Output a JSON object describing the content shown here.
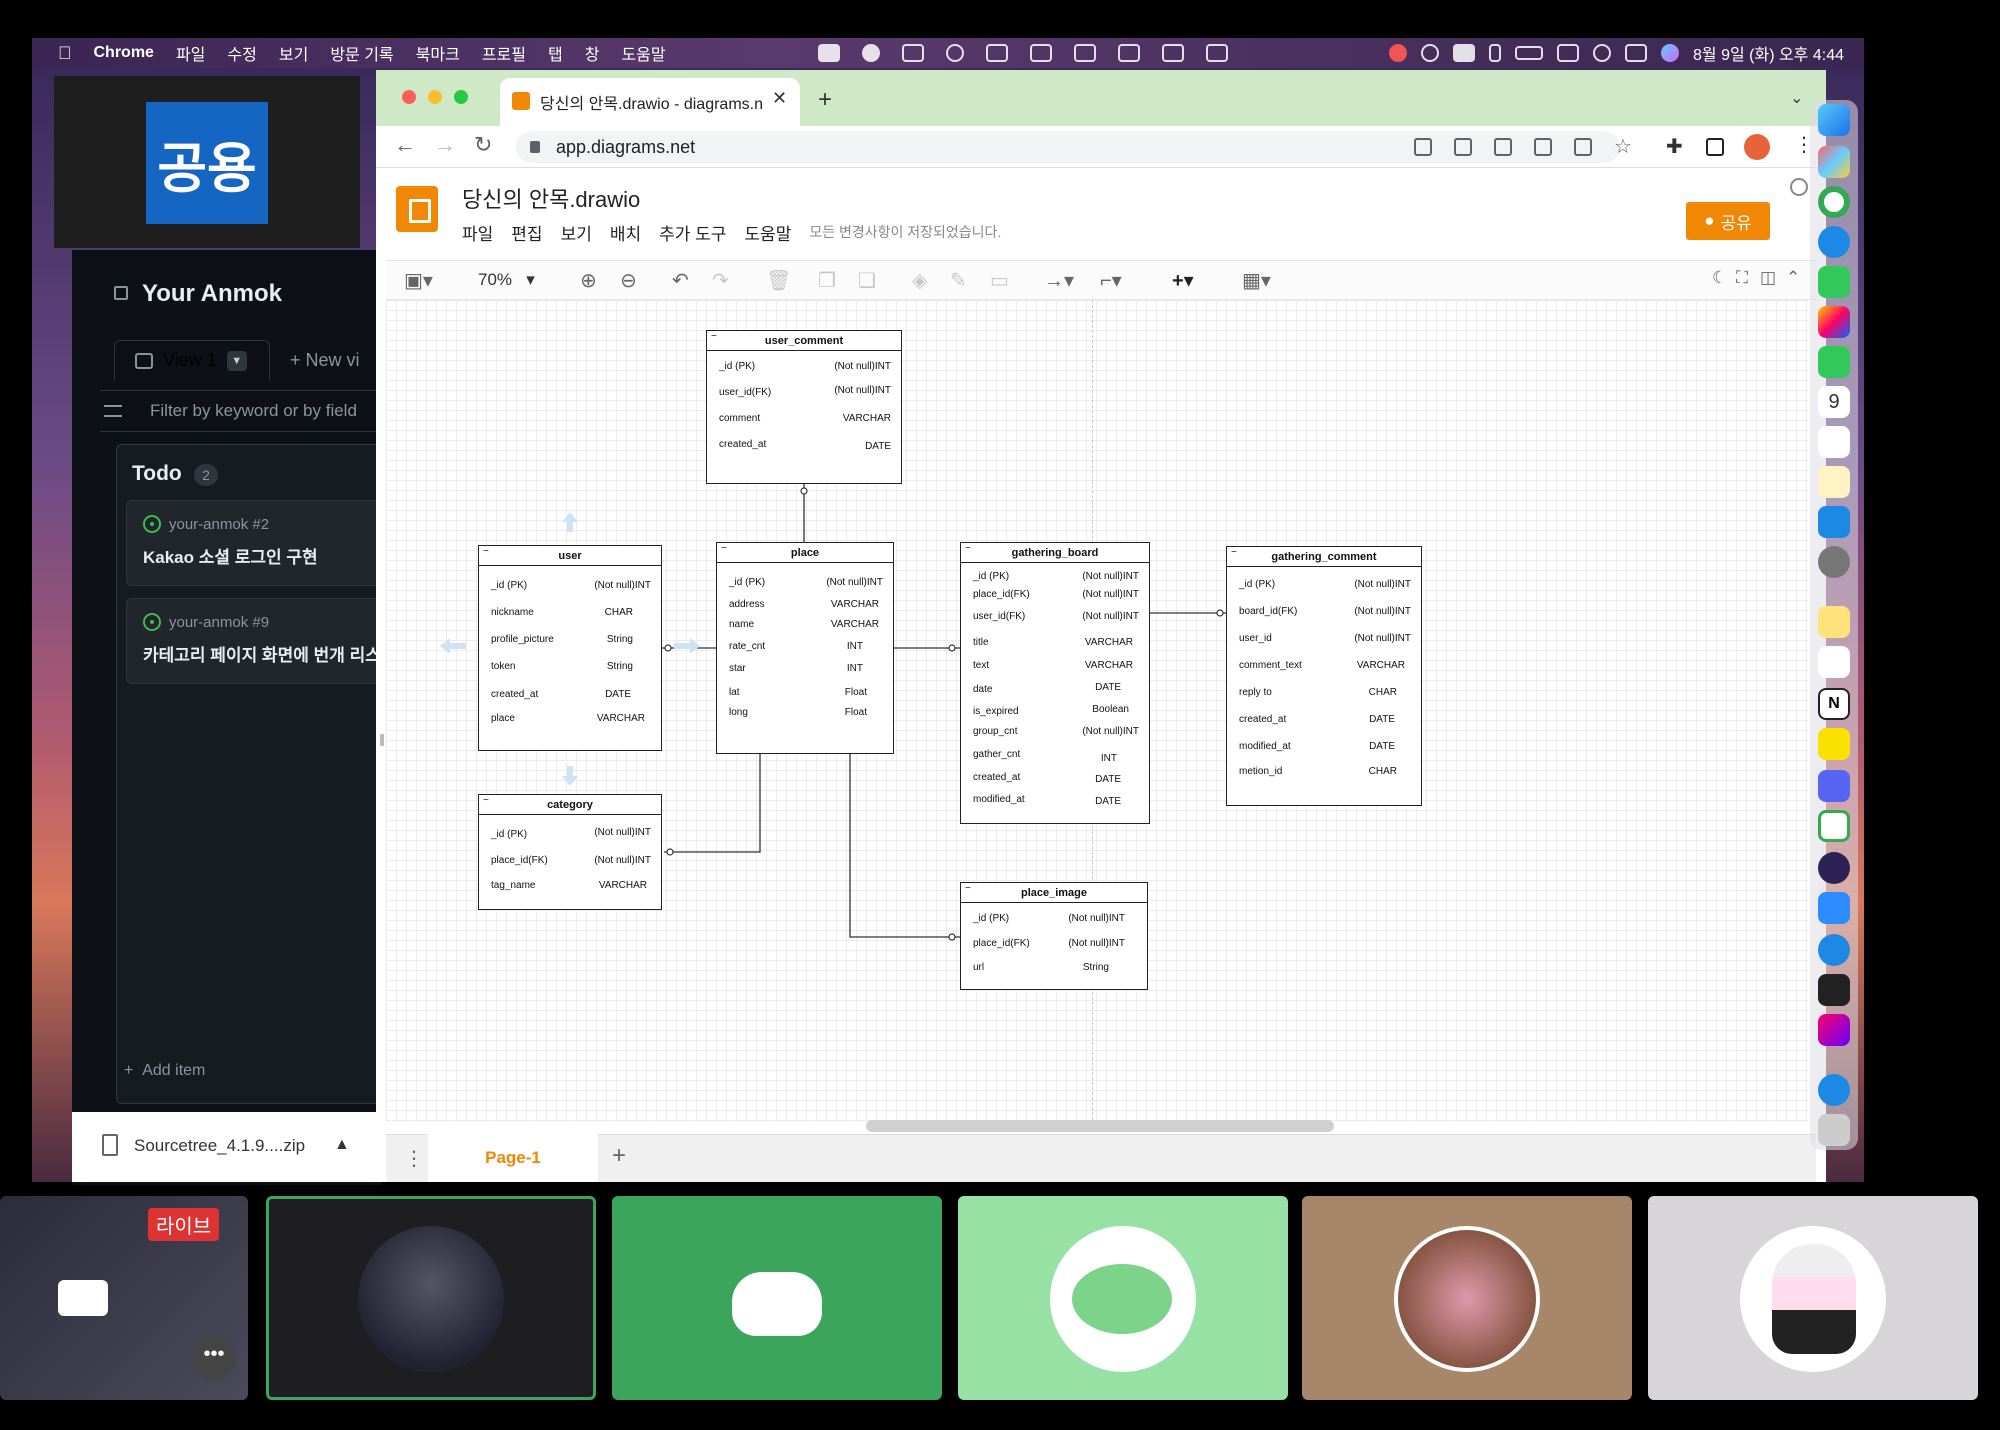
{
  "menubar": {
    "app": "Chrome",
    "items": [
      "파일",
      "수정",
      "보기",
      "방문 기록",
      "북마크",
      "프로필",
      "탭",
      "창",
      "도움말"
    ],
    "clock": "8월 9일 (화) 오후 4:44"
  },
  "share_logo": "공용",
  "github": {
    "project_title": "Your Anmok",
    "view_tab": "View 1",
    "new_view": "New vi",
    "filter_placeholder": "Filter by keyword or by field",
    "column_title": "Todo",
    "column_count": "2",
    "cards": [
      {
        "ref": "your-anmok #2",
        "title": "Kakao 소셜 로그인 구현"
      },
      {
        "ref": "your-anmok #9",
        "title": "카테고리 페이지 화면에 번개 리스"
      }
    ],
    "add_item": "Add item"
  },
  "download": {
    "file": "Sourcetree_4.1.9....zip"
  },
  "browser": {
    "tab_title": "당신의 안목.drawio - diagrams.n",
    "url": "app.diagrams.net"
  },
  "drawio": {
    "file_title": "당신의 안목.drawio",
    "menu": [
      "파일",
      "편집",
      "보기",
      "배치",
      "추가 도구",
      "도움말"
    ],
    "saved_status": "모든 변경사항이 저장되었습니다.",
    "share_button": "공유",
    "zoom": "70%",
    "page_tab": "Page-1"
  },
  "diagram": {
    "tables": {
      "user_comment": {
        "name": "user_comment",
        "rows": [
          [
            "_id (PK)",
            "(Not null)INT"
          ],
          [
            "user_id(FK)",
            "(Not null)INT"
          ],
          [
            "comment",
            "VARCHAR"
          ],
          [
            "created_at",
            "DATE"
          ]
        ]
      },
      "user": {
        "name": "user",
        "rows": [
          [
            "_id (PK)",
            "(Not null)INT"
          ],
          [
            "nickname",
            "CHAR"
          ],
          [
            "profile_picture",
            "String"
          ],
          [
            "token",
            "String"
          ],
          [
            "created_at",
            "DATE"
          ],
          [
            "place",
            "VARCHAR"
          ]
        ]
      },
      "place": {
        "name": "place",
        "rows": [
          [
            "_id (PK)",
            "(Not null)INT"
          ],
          [
            "address",
            "VARCHAR"
          ],
          [
            "name",
            "VARCHAR"
          ],
          [
            "rate_cnt",
            "INT"
          ],
          [
            "star",
            "INT"
          ],
          [
            "lat",
            "Float"
          ],
          [
            "long",
            "Float"
          ]
        ]
      },
      "gathering_board": {
        "name": "gathering_board",
        "rows": [
          [
            "_id (PK)",
            "(Not null)INT"
          ],
          [
            "place_id(FK)",
            "(Not null)INT"
          ],
          [
            "user_id(FK)",
            "(Not null)INT"
          ],
          [
            "title",
            "VARCHAR"
          ],
          [
            "text",
            "VARCHAR"
          ],
          [
            "date",
            "DATE"
          ],
          [
            "is_expired",
            "Boolean"
          ],
          [
            "group_cnt",
            "(Not null)INT"
          ],
          [
            "gather_cnt",
            "INT"
          ],
          [
            "created_at",
            "DATE"
          ],
          [
            "modified_at",
            "DATE"
          ]
        ]
      },
      "gathering_comment": {
        "name": "gathering_comment",
        "rows": [
          [
            "_id (PK)",
            "(Not null)INT"
          ],
          [
            "board_id(FK)",
            "(Not null)INT"
          ],
          [
            "user_id",
            "(Not null)INT"
          ],
          [
            "comment_text",
            "VARCHAR"
          ],
          [
            "reply to",
            "CHAR"
          ],
          [
            "created_at",
            "DATE"
          ],
          [
            "modified_at",
            "DATE"
          ],
          [
            "metion_id",
            "CHAR"
          ]
        ]
      },
      "category": {
        "name": "category",
        "rows": [
          [
            "_id (PK)",
            "(Not null)INT"
          ],
          [
            "place_id(FK)",
            "(Not null)INT"
          ],
          [
            "tag_name",
            "VARCHAR"
          ]
        ]
      },
      "place_image": {
        "name": "place_image",
        "rows": [
          [
            "_id (PK)",
            "(Not null)INT"
          ],
          [
            "place_id(FK)",
            "(Not null)INT"
          ],
          [
            "url",
            "String"
          ]
        ]
      }
    }
  },
  "call": {
    "live_badge": "라이브"
  },
  "colors": {
    "drawio_orange": "#f08705",
    "discord_tile": "#3ba55c",
    "selected_tile_border": "#3ba55c"
  }
}
